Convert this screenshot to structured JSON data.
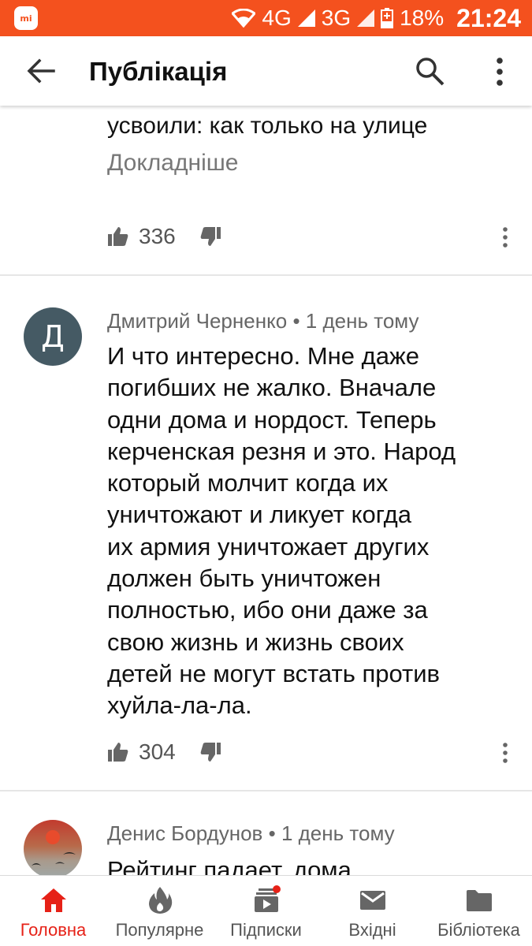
{
  "status_bar": {
    "network1": "4G",
    "network2": "3G",
    "battery": "18%",
    "time": "21:24"
  },
  "app_bar": {
    "title": "Публікація"
  },
  "colors": {
    "status_bar": "#f4511e",
    "accent": "#e62117",
    "avatar_d": "#455a64"
  },
  "first_comment": {
    "partial_text": "усвоили: как только на улице",
    "read_more": "Докладніше",
    "likes": "336"
  },
  "comments": [
    {
      "avatar_letter": "Д",
      "author": "Дмитрий Черненко",
      "time": "1 день тому",
      "separator": "•",
      "text": "И что интересно. Мне даже\nпогибших не жалко. Вначале\nодни дома и нордост. Теперь\nкерченская резня и это. Народ\nкоторый молчит когда их\nуничтожают и ликует когда\nих армия уничтожает других\nдолжен быть уничтожен\nполностью, ибо они даже за\nсвою жизнь и жизнь своих\nдетей не могут встать против\nхуйла-ла-ла.",
      "likes": "304"
    },
    {
      "author": "Денис Бордунов",
      "time": "1 день тому",
      "separator": "•",
      "text": "Рейтинг падает, дома"
    }
  ],
  "bottom_nav": [
    {
      "label": "Головна",
      "icon": "home-icon",
      "active": true
    },
    {
      "label": "Популярне",
      "icon": "flame-icon",
      "active": false
    },
    {
      "label": "Підписки",
      "icon": "subscriptions-icon",
      "active": false
    },
    {
      "label": "Вхідні",
      "icon": "inbox-icon",
      "active": false
    },
    {
      "label": "Бібліотека",
      "icon": "library-icon",
      "active": false
    }
  ]
}
